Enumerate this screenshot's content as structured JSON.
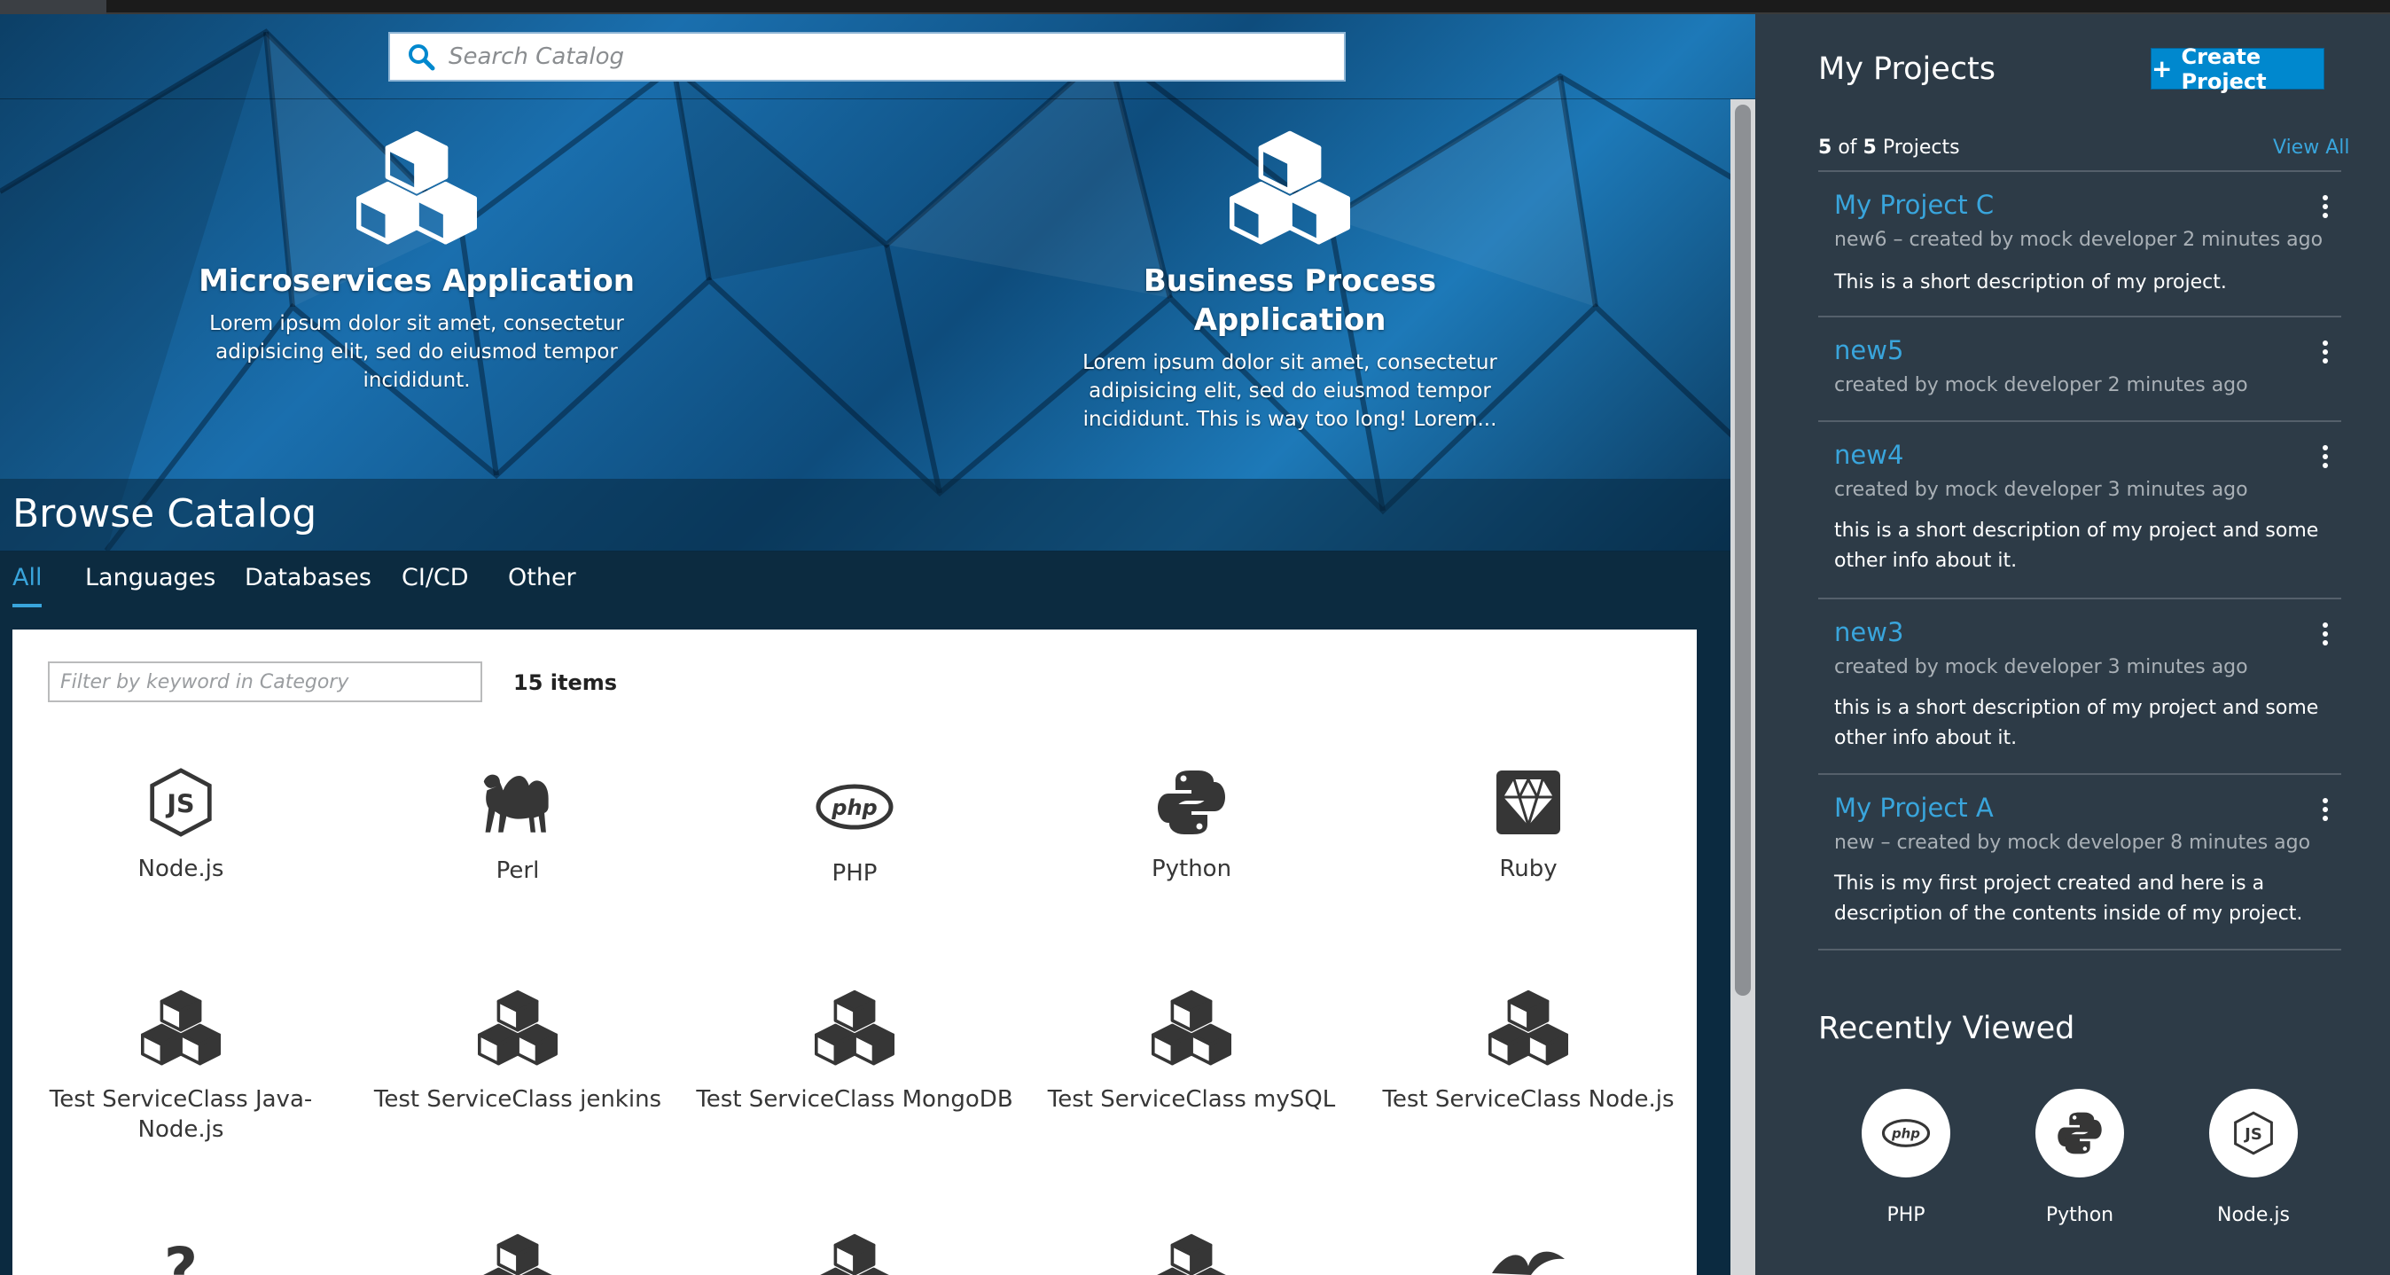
{
  "search": {
    "placeholder": "Search Catalog"
  },
  "featured": [
    {
      "title": "Microservices Application",
      "description": "Lorem ipsum dolor sit amet, consectetur adipisicing elit, sed do eiusmod tempor incididunt."
    },
    {
      "title": "Business Process Application",
      "description": "Lorem ipsum dolor sit amet, consectetur adipisicing elit, sed do eiusmod tempor incididunt. This is way too long! Lorem..."
    }
  ],
  "catalog": {
    "title": "Browse Catalog",
    "tabs": [
      "All",
      "Languages",
      "Databases",
      "CI/CD",
      "Other"
    ],
    "active_tab": "All",
    "filter_placeholder": "Filter by keyword in Category",
    "item_count": "15 items",
    "items": [
      {
        "label": "Node.js",
        "icon": "nodejs-icon"
      },
      {
        "label": "Perl",
        "icon": "perl-camel-icon"
      },
      {
        "label": "PHP",
        "icon": "php-icon"
      },
      {
        "label": "Python",
        "icon": "python-icon"
      },
      {
        "label": "Ruby",
        "icon": "ruby-gem-icon"
      },
      {
        "label": "Test ServiceClass Java-Node.js",
        "icon": "cubes-icon"
      },
      {
        "label": "Test ServiceClass jenkins",
        "icon": "cubes-icon"
      },
      {
        "label": "Test ServiceClass MongoDB",
        "icon": "cubes-icon"
      },
      {
        "label": "Test ServiceClass mySQL",
        "icon": "cubes-icon"
      },
      {
        "label": "Test ServiceClass Node.js",
        "icon": "cubes-icon"
      }
    ]
  },
  "projects": {
    "title": "My Projects",
    "create_label": "Create Project",
    "count_shown": "5",
    "count_of": "of",
    "count_total": "5",
    "count_suffix": "Projects",
    "view_all": "View All",
    "list": [
      {
        "name": "My Project C",
        "meta": "new6 – created by mock developer 2 minutes ago",
        "description": "This is a short description of my project."
      },
      {
        "name": "new5",
        "meta": "created by mock developer 2 minutes ago",
        "description": ""
      },
      {
        "name": "new4",
        "meta": "created by mock developer 3 minutes ago",
        "description": "this is a short description of my project and some other info about it."
      },
      {
        "name": "new3",
        "meta": "created by mock developer 3 minutes ago",
        "description": "this is a short description of my project and some other info about it."
      },
      {
        "name": "My Project A",
        "meta": "new – created by mock developer 8 minutes ago",
        "description": "This is my first project created and here is a description of the contents inside of my project."
      }
    ]
  },
  "recently_viewed": {
    "title": "Recently Viewed",
    "items": [
      {
        "label": "PHP",
        "icon": "php-icon"
      },
      {
        "label": "Python",
        "icon": "python-icon"
      },
      {
        "label": "Node.js",
        "icon": "nodejs-icon"
      }
    ]
  },
  "colors": {
    "accent": "#39a5dc",
    "button": "#0088ce",
    "sidebar_bg": "#2d3b47",
    "hero_blue": "#1a6fae"
  }
}
